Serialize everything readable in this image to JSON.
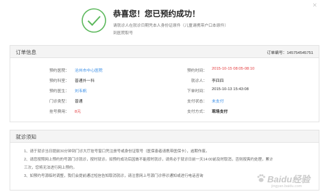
{
  "close_label": "×",
  "success": {
    "title": "恭喜您！您已预约成功！",
    "line1": "请就诊人在就诊日期凭本人身份证原件（儿童请携带户口本原件）",
    "line2": "到医院取号",
    "icon": "check-circle-icon",
    "accent": "#5cb85c"
  },
  "order": {
    "title": "订单信息",
    "order_no_label": "订单编号：",
    "order_no": "145754545751",
    "rows": [
      {
        "left_label": "预约医院：",
        "left_value": "沧州市中心医院",
        "right_label": "预约时间：",
        "right_value": "2015-10-15 08:05-08:10"
      },
      {
        "left_label": "预约科室：",
        "left_value": "普通外一科",
        "right_label": "就诊人：",
        "right_value": "李四四"
      },
      {
        "left_label": "预约医生：",
        "left_value": "刘韦帆",
        "right_label": "下单时间：",
        "right_value": "2015-10-13 15:43:08"
      },
      {
        "left_label": "门诊类型：",
        "left_value": "普通",
        "right_label": "支付状态：",
        "right_value": "未支付"
      },
      {
        "left_label": "挂号费用：",
        "left_value": "8元",
        "right_label": "支付方式：",
        "right_value": "现场支付"
      }
    ]
  },
  "notice": {
    "title": "就诊须知",
    "items": [
      "1、请于就诊当日提前30分钟到门诊大厅挂号窗口凭注册号或身份证取号（医保患者请携带医保卡），逾期作废。",
      "2、请您按照网上预约的号源门诊就诊，按时就诊。如预约成功后因故不能按时就诊，请务必于就诊日前一天14:00前及时取消，否则按爽约处理，累计",
      "三次，您将无法进行网上预约。",
      "3、如预约号源临时调整，我们会提前通过短信告知取消就诊，请注意网上号源门诊停诊通知或进行电话咨询"
    ]
  },
  "watermark": {
    "text": "Baidu经验",
    "sub": "jingyan.baidu.com"
  }
}
